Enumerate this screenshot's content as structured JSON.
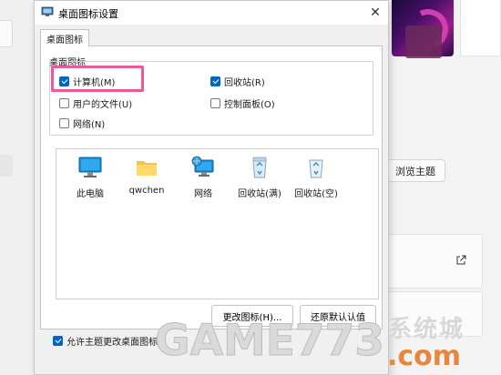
{
  "background": {
    "browse_theme_button": "浏览主题"
  },
  "dialog": {
    "title": "桌面图标设置",
    "close_glyph": "✕",
    "tab_label": "桌面图标",
    "group_label": "桌面图标",
    "checkboxes": [
      {
        "label": "计算机(M)",
        "checked": true
      },
      {
        "label": "回收站(R)",
        "checked": true
      },
      {
        "label": "用户的文件(U)",
        "checked": false
      },
      {
        "label": "控制面板(O)",
        "checked": false
      },
      {
        "label": "网络(N)",
        "checked": false
      }
    ],
    "icons": [
      {
        "label": "此电脑",
        "icon": "monitor-icon"
      },
      {
        "label": "qwchen",
        "icon": "folder-icon"
      },
      {
        "label": "网络",
        "icon": "network-icon"
      },
      {
        "label": "回收站(满)",
        "icon": "recycle-bin-full-icon"
      },
      {
        "label": "回收站(空)",
        "icon": "recycle-bin-empty-icon"
      }
    ],
    "change_icon_button": "更改图标(H)...",
    "restore_default_button": "还原默认认值",
    "allow_theme_checkbox": {
      "label": "允许主题更改桌面图标",
      "checked": true
    }
  },
  "watermark": {
    "game": "GAME773",
    "xitong": "系统城",
    "com": ".com"
  },
  "colors": {
    "accent": "#0067c0",
    "highlight_border": "#e85a9c"
  }
}
